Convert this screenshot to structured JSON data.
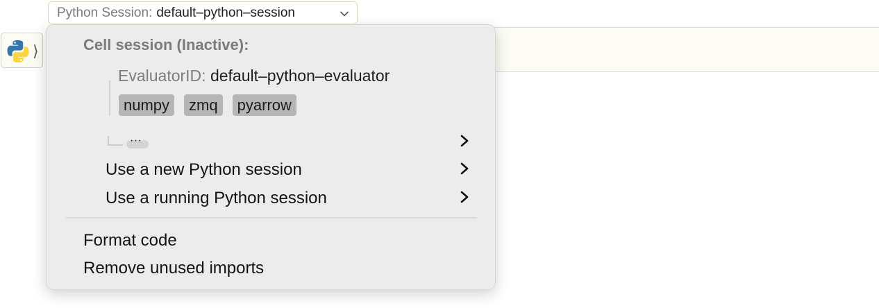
{
  "session_selector": {
    "label": "Python Session:",
    "value": "default–python–session",
    "icon": "chevron-down-icon"
  },
  "cell": {
    "language_icon": "python-logo-icon",
    "language_toggle_glyph": "⟩"
  },
  "menu": {
    "heading": "Cell session (Inactive):",
    "evaluator_key": "EvaluatorID:",
    "evaluator_value": "default–python–evaluator",
    "packages": [
      "numpy",
      "zmq",
      "pyarrow"
    ],
    "more_label": "···",
    "items": [
      {
        "label": "Use a new Python session",
        "submenu": true
      },
      {
        "label": "Use a running Python session",
        "submenu": true
      }
    ],
    "actions": [
      {
        "label": "Format code"
      },
      {
        "label": "Remove unused imports"
      }
    ]
  },
  "colors": {
    "selector_border": "#dcd6b2",
    "cell_background": "#fcfbf5",
    "menu_background": "#ececec",
    "tag_background": "#b6b6b6",
    "python_blue": "#3776ab",
    "python_yellow": "#ffd43b"
  }
}
